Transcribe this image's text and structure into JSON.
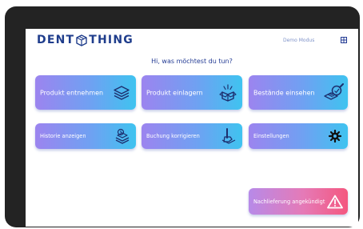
{
  "header": {
    "brand_left": "DENT",
    "brand_right": "THING",
    "mode": "Demo Modus"
  },
  "greeting": "Hi, was möchtest du tun?",
  "tiles": [
    {
      "label": "Produkt entnehmen",
      "icon": "layers-icon"
    },
    {
      "label": "Produkt einlagern",
      "icon": "open-box-icon"
    },
    {
      "label": "Bestände einsehen",
      "icon": "inventory-scan-icon"
    },
    {
      "label": "Historie anzeigen",
      "icon": "history-stack-icon"
    },
    {
      "label": "Buchung korrigieren",
      "icon": "hand-correct-icon"
    },
    {
      "label": "Einstellungen",
      "icon": "gear-icon"
    },
    {
      "label": "Nachlieferung angekündigt",
      "icon": "warning-icon"
    }
  ],
  "colors": {
    "brand": "#1f3d8c",
    "tile_start": "#9c84ef",
    "tile_end": "#3fc3f0",
    "alert_end": "#f4577f"
  }
}
